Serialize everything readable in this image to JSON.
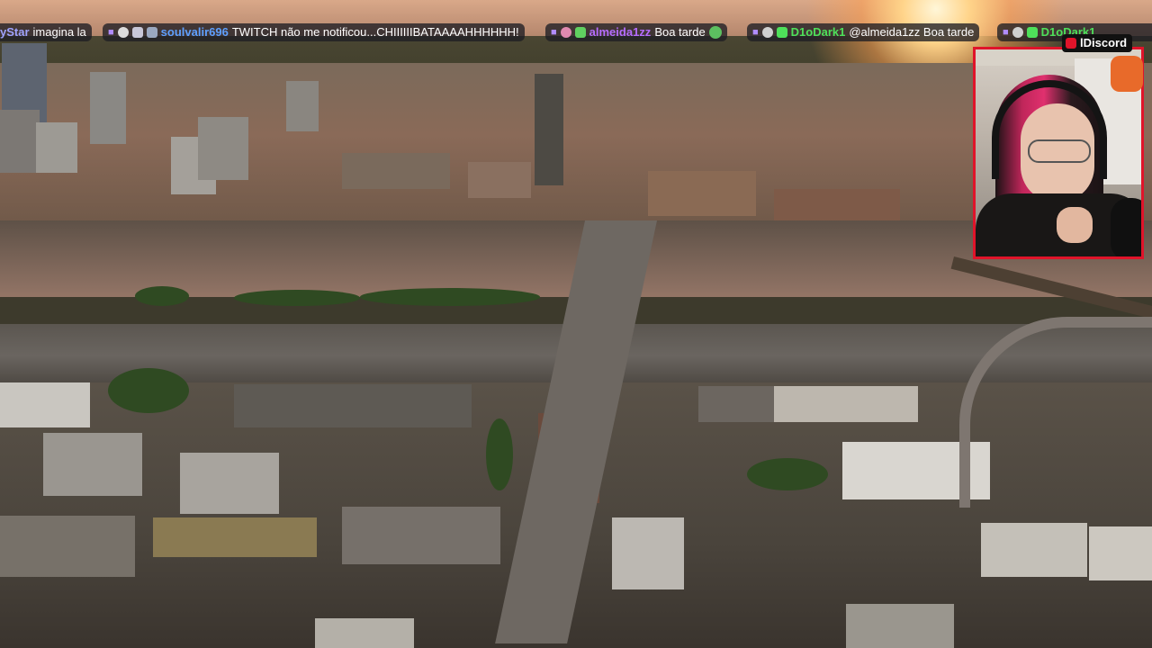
{
  "chat": {
    "messages": [
      {
        "user": "yStar",
        "user_color": "#9fa3ff",
        "text": "imagina la"
      },
      {
        "user": "soulvalir696",
        "user_color": "#5ea0ff",
        "text": "TWITCH não me notificou...CHIIIIIIBATAAAAHHHHHH!"
      },
      {
        "user": "almeida1zz",
        "user_color": "#b56cff",
        "text": "Boa tarde"
      },
      {
        "user": "D1oDark1",
        "user_color": "#4ee05a",
        "text": "@almeida1zz Boa tarde"
      },
      {
        "user": "D1oDark1",
        "user_color": "#4ee05a",
        "text": ""
      }
    ]
  },
  "overlay": {
    "discord_label": "lDiscord"
  }
}
